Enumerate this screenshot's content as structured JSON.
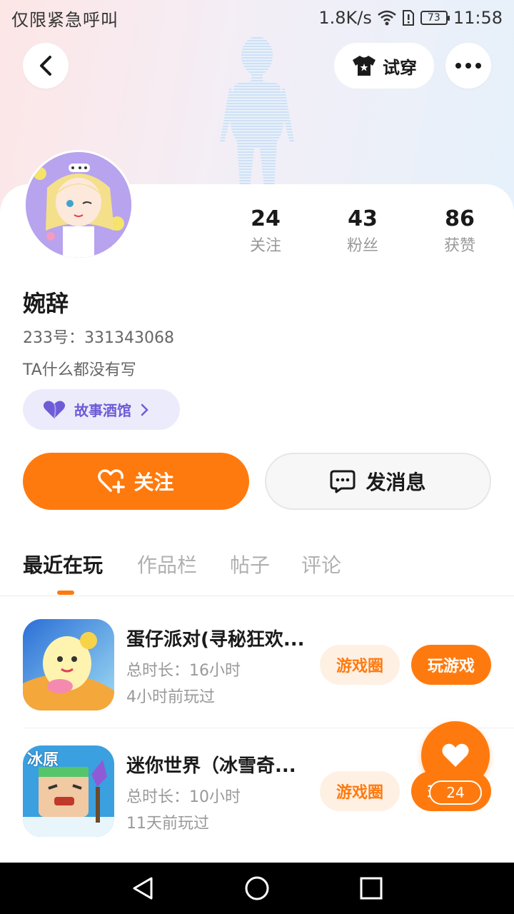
{
  "status_bar": {
    "carrier": "仅限紧急呼叫",
    "net_speed": "1.8K/s",
    "battery": "73",
    "time": "11:58"
  },
  "header": {
    "try_on_label": "试穿"
  },
  "profile": {
    "name": "婉辞",
    "id_line": "233号：331343068",
    "bio": "TA什么都没有写",
    "tag": "故事酒馆",
    "stats": [
      {
        "num": "24",
        "label": "关注"
      },
      {
        "num": "43",
        "label": "粉丝"
      },
      {
        "num": "86",
        "label": "获赞"
      }
    ]
  },
  "actions": {
    "follow": "关注",
    "message": "发消息"
  },
  "tabs": [
    "最近在玩",
    "作品栏",
    "帖子",
    "评论"
  ],
  "games": [
    {
      "title": "蛋仔派对(寻秘狂欢...",
      "duration": "总时长：16小时",
      "last_played": "4小时前玩过",
      "circle": "游戏圈",
      "play": "玩游戏"
    },
    {
      "title": "迷你世界（冰雪奇...",
      "duration": "总时长：10小时",
      "last_played": "11天前玩过",
      "circle": "游戏圈",
      "play": "玩游戏",
      "icon_text": "冰原"
    }
  ],
  "floating": {
    "like_count": "24"
  },
  "colors": {
    "accent": "#ff7a0e",
    "tag_purple": "#6e5bd6",
    "tag_bg": "#ecebfb"
  }
}
